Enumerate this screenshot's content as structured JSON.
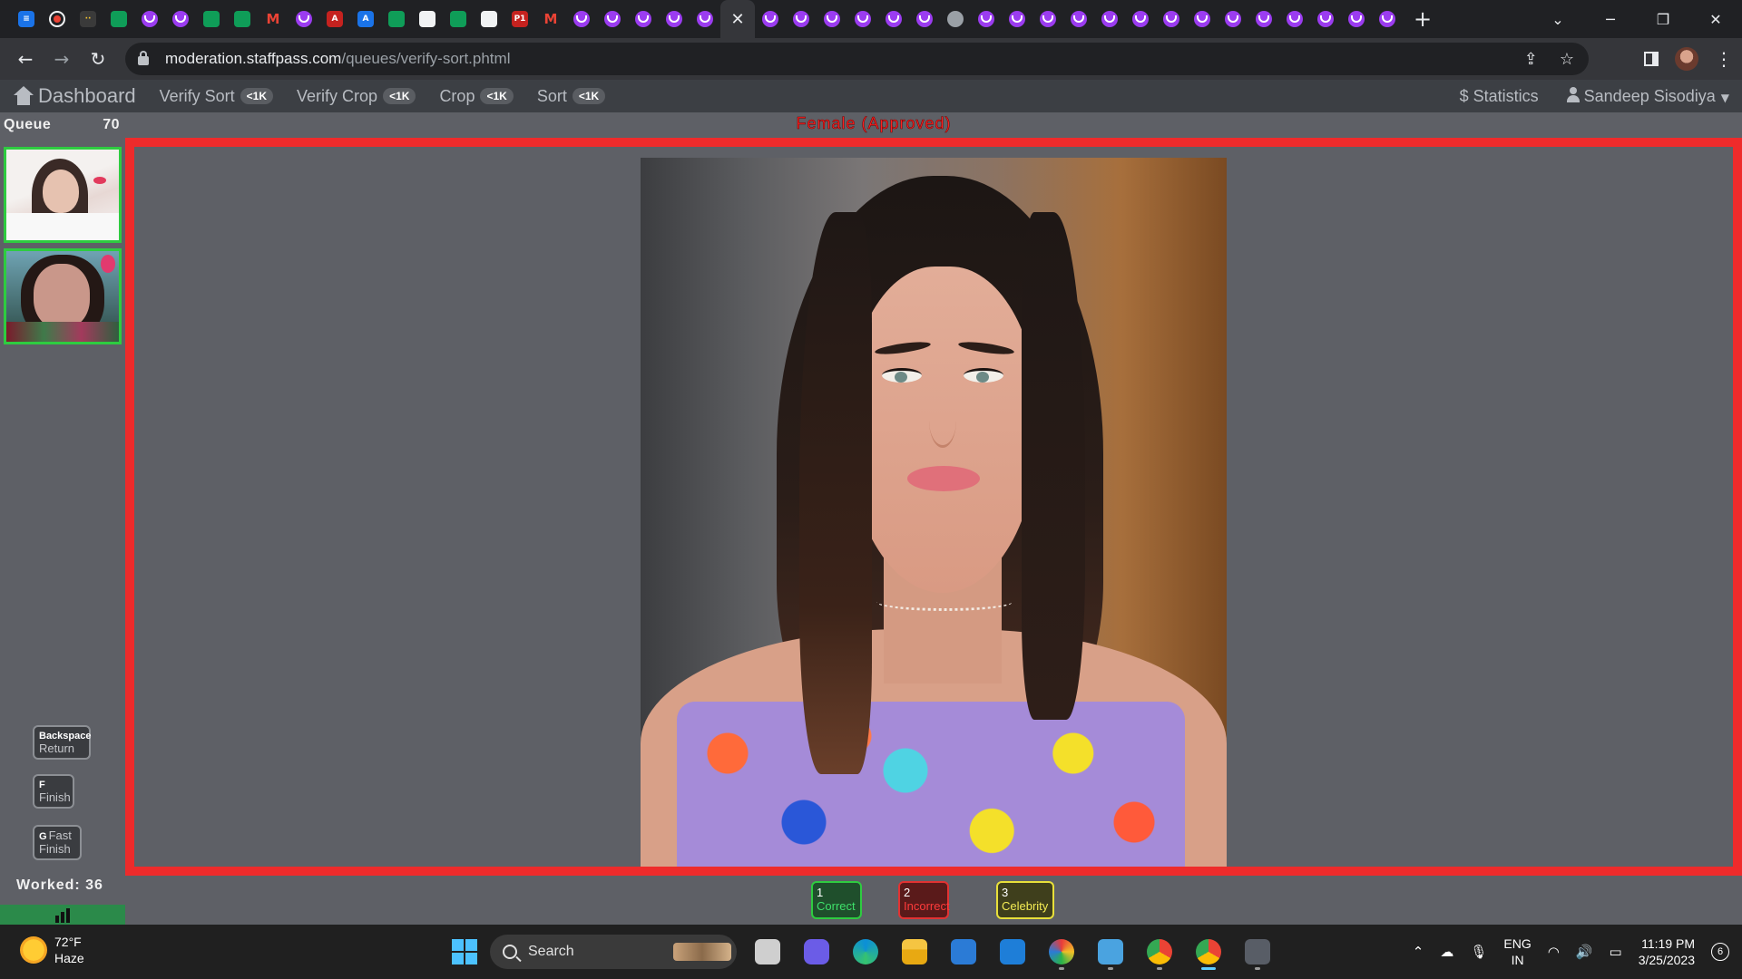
{
  "browser": {
    "url_host": "moderation.staffpass.com",
    "url_path": "/queues/verify-sort.phtml"
  },
  "appnav": {
    "brand": "Dashboard",
    "links": [
      {
        "label": "Verify Sort",
        "badge": "<1K"
      },
      {
        "label": "Verify Crop",
        "badge": "<1K"
      },
      {
        "label": "Crop",
        "badge": "<1K"
      },
      {
        "label": "Sort",
        "badge": "<1K"
      }
    ],
    "statistics": "$ Statistics",
    "user": "Sandeep Sisodiya"
  },
  "sidebar": {
    "queue_label": "Queue",
    "queue_count": "70",
    "keys": [
      {
        "key": "Backspace",
        "label": "Return"
      },
      {
        "key": "F",
        "label": "Finish"
      },
      {
        "key": "G",
        "label1": "Fast",
        "label2": "Finish"
      }
    ],
    "worked": "Worked: 36"
  },
  "review": {
    "status_label": "Female (Approved)"
  },
  "actions": [
    {
      "num": "1",
      "label": "Correct"
    },
    {
      "num": "2",
      "label": "Incorrect"
    },
    {
      "num": "3",
      "label": "Celebrity"
    }
  ],
  "taskbar": {
    "temp": "72°F",
    "weather": "Haze",
    "search_label": "Search",
    "lang_top": "ENG",
    "lang_bottom": "IN",
    "time": "11:19 PM",
    "date": "3/25/2023",
    "notifications": "6"
  },
  "colors": {
    "frame": "#ee2b2b",
    "correct": "#2ecc40",
    "incorrect": "#e23232",
    "celebrity": "#e8e03a"
  }
}
